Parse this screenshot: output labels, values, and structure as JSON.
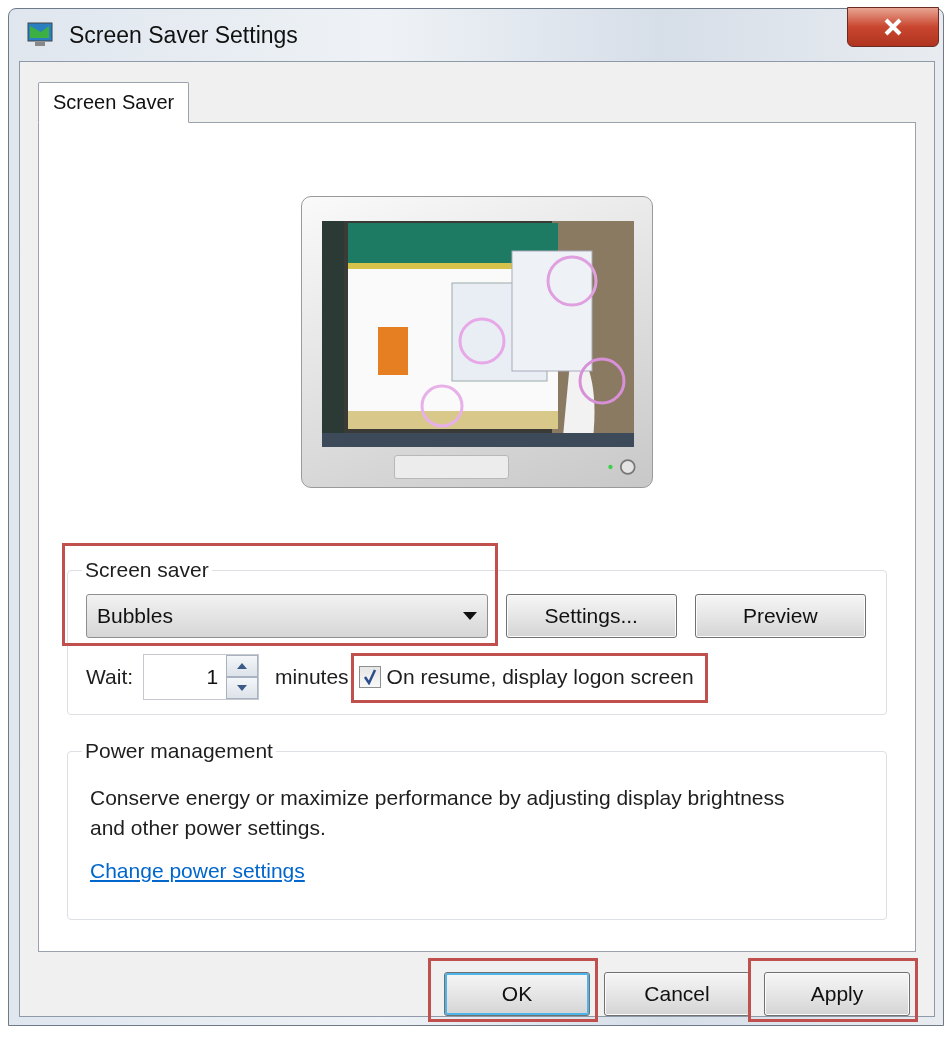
{
  "window": {
    "title": "Screen Saver Settings"
  },
  "tabs": [
    {
      "label": "Screen Saver",
      "selected": true
    }
  ],
  "screen_saver": {
    "legend": "Screen saver",
    "highlighted": true,
    "dropdown": {
      "value": "Bubbles"
    },
    "buttons": [
      "Settings...",
      "Preview"
    ],
    "wait_label": "Wait:",
    "wait_value": "1",
    "wait_unit": "minutes",
    "logon_option": {
      "label": "On resume, display logon screen",
      "checked": true,
      "highlighted": true
    }
  },
  "power_management": {
    "legend": "Power management",
    "description": "Conserve energy or maximize performance by adjusting display brightness and other power settings.",
    "link": "Change power settings"
  },
  "buttons": [
    {
      "label": "OK",
      "default": true,
      "highlighted": true
    },
    {
      "label": "Cancel",
      "default": false,
      "highlighted": false
    },
    {
      "label": "Apply",
      "default": false,
      "highlighted": true
    }
  ]
}
